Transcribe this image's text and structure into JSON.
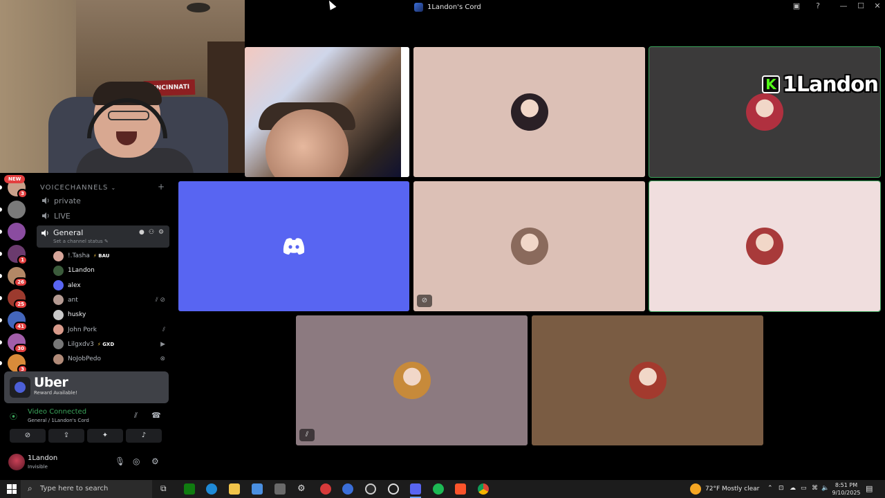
{
  "window": {
    "title": "1Landon's Cord"
  },
  "webcam": {
    "pennant_text": "CINCINNATI"
  },
  "guilds": [
    {
      "color": "#c9a08a",
      "badge": "3"
    },
    {
      "color": "#7a7a7a",
      "badge": ""
    },
    {
      "color": "#8a4ca0",
      "badge": ""
    },
    {
      "color": "#6b3b6e",
      "badge": "1"
    },
    {
      "color": "#b38866",
      "badge": "26"
    },
    {
      "color": "#9c3a2e",
      "badge": "25"
    },
    {
      "color": "#4466bb",
      "badge": "41"
    },
    {
      "color": "#a15eaa",
      "badge": "30"
    },
    {
      "color": "#d88b3a",
      "badge": "3"
    }
  ],
  "new_label": "NEW",
  "channels": {
    "category": "VOICECHANNELS",
    "private": "private",
    "live": "LIVE",
    "general": "General",
    "general_status": "Set a channel status"
  },
  "voice_users": [
    {
      "name": "!.Tasha",
      "tag": "BAU",
      "color": "#d6a59a",
      "right": ""
    },
    {
      "name": "1Landon",
      "tag": "",
      "color": "#3b5b3b",
      "right": "",
      "bright": true
    },
    {
      "name": "alex",
      "tag": "",
      "color": "#5865f2",
      "right": "",
      "bright": true
    },
    {
      "name": "ant",
      "tag": "",
      "color": "#b49a92",
      "right": "muted-deafened"
    },
    {
      "name": "husky",
      "tag": "",
      "color": "#c8c8c8",
      "right": "",
      "bright": true
    },
    {
      "name": "John Pork",
      "tag": "",
      "color": "#d89a8a",
      "right": "muted"
    },
    {
      "name": "Lilgxdv3",
      "tag": "GXD",
      "color": "#777",
      "right": "video"
    },
    {
      "name": "NoJobPedo",
      "tag": "",
      "color": "#b08a78",
      "right": "xbox"
    }
  ],
  "promo": {
    "title": "Uber",
    "subtitle": "Reward Available!"
  },
  "voice_panel": {
    "status": "Video Connected",
    "location": "General / 1Landon's Cord"
  },
  "user_panel": {
    "name": "1Landon",
    "status": "Invisible"
  },
  "tiles": [
    {
      "kind": "stream",
      "color": "#111"
    },
    {
      "kind": "avatar",
      "color": "#dcc0b6",
      "avatar": "#2a2026",
      "flag": ""
    },
    {
      "kind": "avatar",
      "color": "#3b3a3a",
      "avatar": "#b0303f",
      "flag": "",
      "speaking": true
    },
    {
      "kind": "discord",
      "color": "#5865f2",
      "flag": ""
    },
    {
      "kind": "avatar",
      "color": "#dcc0b6",
      "avatar": "#8a6a5c",
      "flag": "video-off"
    },
    {
      "kind": "avatar",
      "color": "#f0dede",
      "avatar": "#a83a3a",
      "flag": "",
      "speaking": true
    },
    {
      "kind": "avatar",
      "color": "#8c7a80",
      "avatar": "#c78a3a",
      "flag": "muted"
    },
    {
      "kind": "avatar",
      "color": "#7a5c43",
      "avatar": "#a33a2e",
      "flag": ""
    }
  ],
  "stream_overlay": {
    "name": "1Landon",
    "kick": "K"
  },
  "taskbar": {
    "search_placeholder": "Type here to search",
    "weather": "72°F  Mostly clear",
    "time": "8:51 PM",
    "date": "9/10/2025"
  },
  "colors": {
    "green": "#3ba55c",
    "blurple": "#5865f2",
    "badge_red": "#e33f3f"
  }
}
